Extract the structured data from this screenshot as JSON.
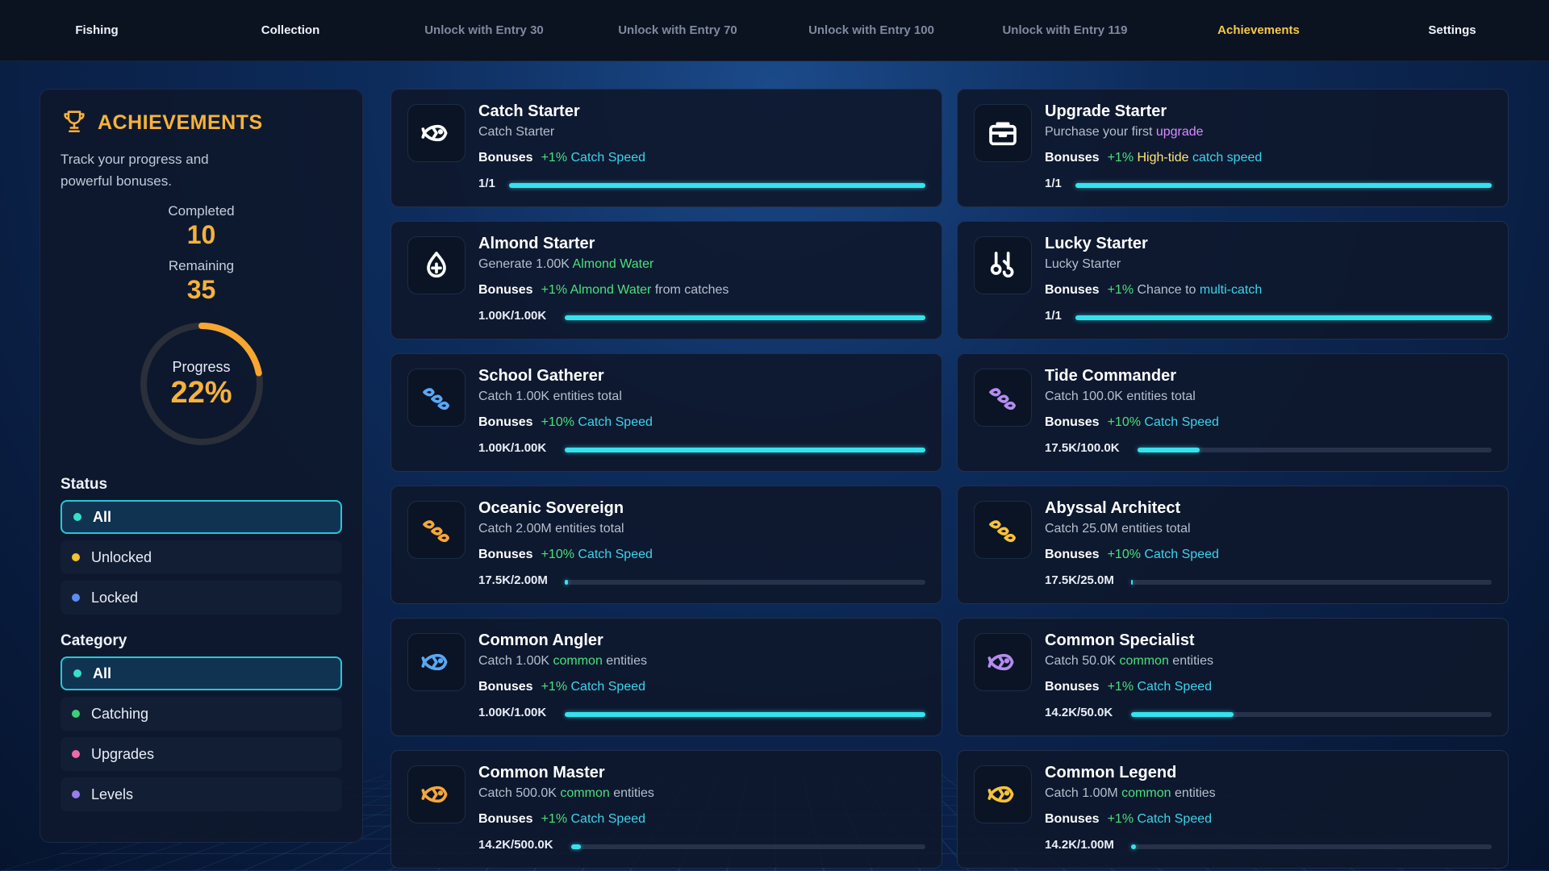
{
  "nav": {
    "tabs": [
      {
        "label": "Fishing"
      },
      {
        "label": "Collection"
      },
      {
        "label": "Unlock with Entry 30"
      },
      {
        "label": "Unlock with Entry 70"
      },
      {
        "label": "Unlock with Entry 100"
      },
      {
        "label": "Unlock with Entry 119"
      },
      {
        "label": "Achievements"
      },
      {
        "label": "Settings"
      }
    ],
    "active": "Achievements"
  },
  "sidebar": {
    "title": "ACHIEVEMENTS",
    "subtitle": "Track your progress and powerful bonuses.",
    "completed_label": "Completed",
    "completed": "10",
    "remaining_label": "Remaining",
    "remaining": "35",
    "progress_label": "Progress",
    "progress_text": "22%",
    "progress_fraction": 0.22,
    "status_heading": "Status",
    "status_filters": [
      {
        "label": "All",
        "dot": "#35e0c8",
        "active": true
      },
      {
        "label": "Unlocked",
        "dot": "#f2c230"
      },
      {
        "label": "Locked",
        "dot": "#5b8ef0"
      }
    ],
    "category_heading": "Category",
    "category_filters": [
      {
        "label": "All",
        "dot": "#35e0c8",
        "active": true
      },
      {
        "label": "Catching",
        "dot": "#3ccf7a"
      },
      {
        "label": "Upgrades",
        "dot": "#f06aa8"
      },
      {
        "label": "Levels",
        "dot": "#9a7cf0"
      }
    ]
  },
  "bonuses_label": "Bonuses",
  "cards": [
    {
      "title": "Catch Starter",
      "desc": [
        {
          "t": "Catch Starter"
        }
      ],
      "bonus": [
        {
          "t": "+1% ",
          "c": "g"
        },
        {
          "t": "Catch Speed",
          "c": "c"
        }
      ],
      "progress": "1/1",
      "fraction": 1.0,
      "icon": "fish-icon",
      "icon_color": "#ffffff"
    },
    {
      "title": "Upgrade Starter",
      "desc": [
        {
          "t": "Purchase your first "
        },
        {
          "t": "upgrade",
          "c": "p"
        }
      ],
      "bonus": [
        {
          "t": "+1% ",
          "c": "g"
        },
        {
          "t": "High-tide ",
          "c": "y"
        },
        {
          "t": "catch speed",
          "c": "c"
        }
      ],
      "progress": "1/1",
      "fraction": 1.0,
      "icon": "toolbox-icon",
      "icon_color": "#ffffff"
    },
    {
      "title": "Almond Starter",
      "desc": [
        {
          "t": "Generate 1.00K "
        },
        {
          "t": "Almond Water",
          "c": "g"
        }
      ],
      "bonus": [
        {
          "t": "+1% ",
          "c": "g"
        },
        {
          "t": "Almond Water",
          "c": "g"
        },
        {
          "t": " from catches"
        }
      ],
      "progress": "1.00K/1.00K",
      "fraction": 1.0,
      "icon": "water-drop-icon",
      "icon_color": "#ffffff"
    },
    {
      "title": "Lucky Starter",
      "desc": [
        {
          "t": "Lucky Starter"
        }
      ],
      "bonus": [
        {
          "t": "+1% ",
          "c": "g"
        },
        {
          "t": "Chance to "
        },
        {
          "t": "multi-catch",
          "c": "c"
        }
      ],
      "progress": "1/1",
      "fraction": 1.0,
      "icon": "hooks-icon",
      "icon_color": "#ffffff"
    },
    {
      "title": "School Gatherer",
      "desc": [
        {
          "t": "Catch 1.00K entities total"
        }
      ],
      "bonus": [
        {
          "t": "+10% ",
          "c": "g"
        },
        {
          "t": "Catch Speed",
          "c": "c"
        }
      ],
      "progress": "1.00K/1.00K",
      "fraction": 1.0,
      "icon": "fish-school-icon",
      "icon_color": "#5aa8f5"
    },
    {
      "title": "Tide Commander",
      "desc": [
        {
          "t": "Catch 100.0K entities total"
        }
      ],
      "bonus": [
        {
          "t": "+10% ",
          "c": "g"
        },
        {
          "t": "Catch Speed",
          "c": "c"
        }
      ],
      "progress": "17.5K/100.0K",
      "fraction": 0.175,
      "icon": "fish-school-icon",
      "icon_color": "#b48cf0"
    },
    {
      "title": "Oceanic Sovereign",
      "desc": [
        {
          "t": "Catch 2.00M entities total"
        }
      ],
      "bonus": [
        {
          "t": "+10% ",
          "c": "g"
        },
        {
          "t": "Catch Speed",
          "c": "c"
        }
      ],
      "progress": "17.5K/2.00M",
      "fraction": 0.009,
      "icon": "fish-school-icon",
      "icon_color": "#f7a63a"
    },
    {
      "title": "Abyssal Architect",
      "desc": [
        {
          "t": "Catch 25.0M entities total"
        }
      ],
      "bonus": [
        {
          "t": "+10% ",
          "c": "g"
        },
        {
          "t": "Catch Speed",
          "c": "c"
        }
      ],
      "progress": "17.5K/25.0M",
      "fraction": 0.001,
      "icon": "fish-school-icon",
      "icon_color": "#f7c23a"
    },
    {
      "title": "Common Angler",
      "desc": [
        {
          "t": "Catch 1.00K "
        },
        {
          "t": "common",
          "c": "g"
        },
        {
          "t": " entities"
        }
      ],
      "bonus": [
        {
          "t": "+1% ",
          "c": "g"
        },
        {
          "t": "Catch Speed",
          "c": "c"
        }
      ],
      "progress": "1.00K/1.00K",
      "fraction": 1.0,
      "icon": "fish-icon",
      "icon_color": "#5aa8f5"
    },
    {
      "title": "Common Specialist",
      "desc": [
        {
          "t": "Catch 50.0K "
        },
        {
          "t": "common",
          "c": "g"
        },
        {
          "t": " entities"
        }
      ],
      "bonus": [
        {
          "t": "+1% ",
          "c": "g"
        },
        {
          "t": "Catch Speed",
          "c": "c"
        }
      ],
      "progress": "14.2K/50.0K",
      "fraction": 0.284,
      "icon": "fish-icon",
      "icon_color": "#b48cf0"
    },
    {
      "title": "Common Master",
      "desc": [
        {
          "t": "Catch 500.0K "
        },
        {
          "t": "common",
          "c": "g"
        },
        {
          "t": " entities"
        }
      ],
      "bonus": [
        {
          "t": "+1% ",
          "c": "g"
        },
        {
          "t": "Catch Speed",
          "c": "c"
        }
      ],
      "progress": "14.2K/500.0K",
      "fraction": 0.028,
      "icon": "fish-icon",
      "icon_color": "#f7a63a"
    },
    {
      "title": "Common Legend",
      "desc": [
        {
          "t": "Catch 1.00M "
        },
        {
          "t": "common",
          "c": "g"
        },
        {
          "t": " entities"
        }
      ],
      "bonus": [
        {
          "t": "+1% ",
          "c": "g"
        },
        {
          "t": "Catch Speed",
          "c": "c"
        }
      ],
      "progress": "14.2K/1.00M",
      "fraction": 0.014,
      "icon": "fish-icon",
      "icon_color": "#f7c23a"
    }
  ]
}
